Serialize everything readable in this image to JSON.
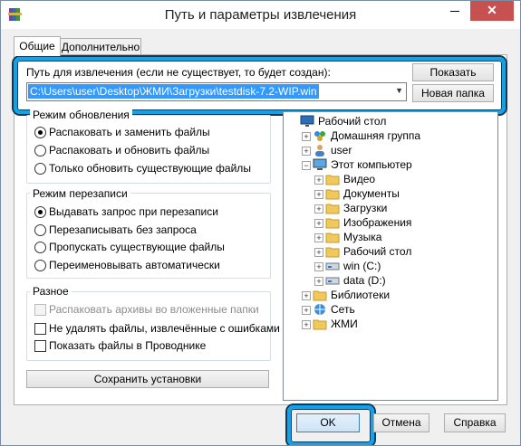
{
  "window": {
    "title": "Путь и параметры извлечения",
    "close_symbol": "✕"
  },
  "tabs": {
    "general": "Общие",
    "advanced": "Дополнительно"
  },
  "destination": {
    "label": "Путь для извлечения (если не существует, то будет создан):",
    "path": "C:\\Users\\user\\Desktop\\ЖМИ\\Загрузки\\testdisk-7.2-WIP.win",
    "show_button": "Показать",
    "new_folder_button": "Новая папка"
  },
  "update_mode": {
    "title": "Режим обновления",
    "options": [
      "Распаковать и заменить файлы",
      "Распаковать и обновить файлы",
      "Только обновить существующие файлы"
    ],
    "selected": 0
  },
  "overwrite_mode": {
    "title": "Режим перезаписи",
    "options": [
      "Выдавать запрос при перезаписи",
      "Перезаписывать без запроса",
      "Пропускать существующие файлы",
      "Переименовывать автоматически"
    ],
    "selected": 0
  },
  "misc": {
    "title": "Разное",
    "options": [
      "Распаковать архивы во вложенные папки",
      "Не удалять файлы, извлечённые с ошибками",
      "Показать файлы в Проводнике"
    ],
    "disabled": [
      true,
      false,
      false
    ]
  },
  "save_settings_button": "Сохранить установки",
  "tree": [
    {
      "label": "Рабочий стол",
      "icon": "desktop-icon"
    },
    {
      "label": "Домашняя группа",
      "icon": "homegroup-icon"
    },
    {
      "label": "user",
      "icon": "user-icon"
    },
    {
      "label": "Этот компьютер",
      "icon": "computer-icon"
    },
    {
      "label": "Видео",
      "icon": "folder-icon"
    },
    {
      "label": "Документы",
      "icon": "folder-icon"
    },
    {
      "label": "Загрузки",
      "icon": "folder-icon"
    },
    {
      "label": "Изображения",
      "icon": "folder-icon"
    },
    {
      "label": "Музыка",
      "icon": "folder-icon"
    },
    {
      "label": "Рабочий стол",
      "icon": "folder-icon"
    },
    {
      "label": "win (C:)",
      "icon": "drive-icon"
    },
    {
      "label": "data (D:)",
      "icon": "drive-icon"
    },
    {
      "label": "Библиотеки",
      "icon": "folder-icon"
    },
    {
      "label": "Сеть",
      "icon": "network-icon"
    },
    {
      "label": "ЖМИ",
      "icon": "folder-icon"
    }
  ],
  "footer": {
    "ok": "OK",
    "cancel": "Отмена",
    "help": "Справка"
  },
  "colors": {
    "highlight": "#13a2e8",
    "selection": "#3399ff",
    "close": "#c75050"
  }
}
